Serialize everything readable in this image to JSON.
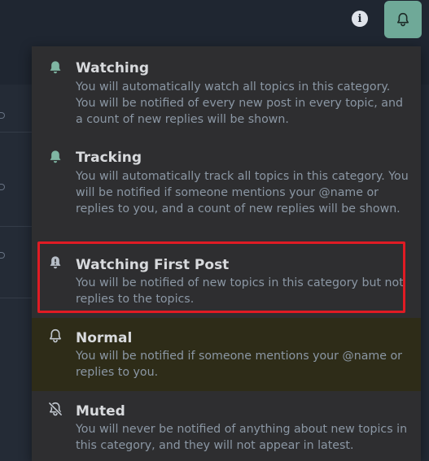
{
  "header": {
    "info_icon": "info-icon",
    "bell_icon": "bell-icon",
    "bell_button_color": "#6fa998",
    "info_glyph": "i"
  },
  "menu": {
    "items": [
      {
        "title": "Watching",
        "description": "You will automatically watch all topics in this category. You will be notified of every new post in every topic, and a count of new replies will be shown.",
        "icon": "bell-filled-icon"
      },
      {
        "title": "Tracking",
        "description": "You will automatically track all topics in this category. You will be notified if someone mentions your @name or replies to you, and a count of new replies will be shown.",
        "icon": "bell-filled-icon"
      },
      {
        "title": "Watching First Post",
        "description": "You will be notified of new topics in this category but not replies to the topics.",
        "icon": "bell-exclamation-icon"
      },
      {
        "title": "Normal",
        "description": "You will be notified if someone mentions your @name or replies to you.",
        "icon": "bell-outline-icon"
      },
      {
        "title": "Muted",
        "description": "You will never be notified of anything about new topics in this category, and they will not appear in latest.",
        "icon": "bell-slash-icon"
      }
    ]
  },
  "colors": {
    "accent_green": "#7fb6a3",
    "selection_outline": "#e01b24",
    "highlight_bg": "#2e2c18",
    "menu_bg": "#2e2e30"
  }
}
